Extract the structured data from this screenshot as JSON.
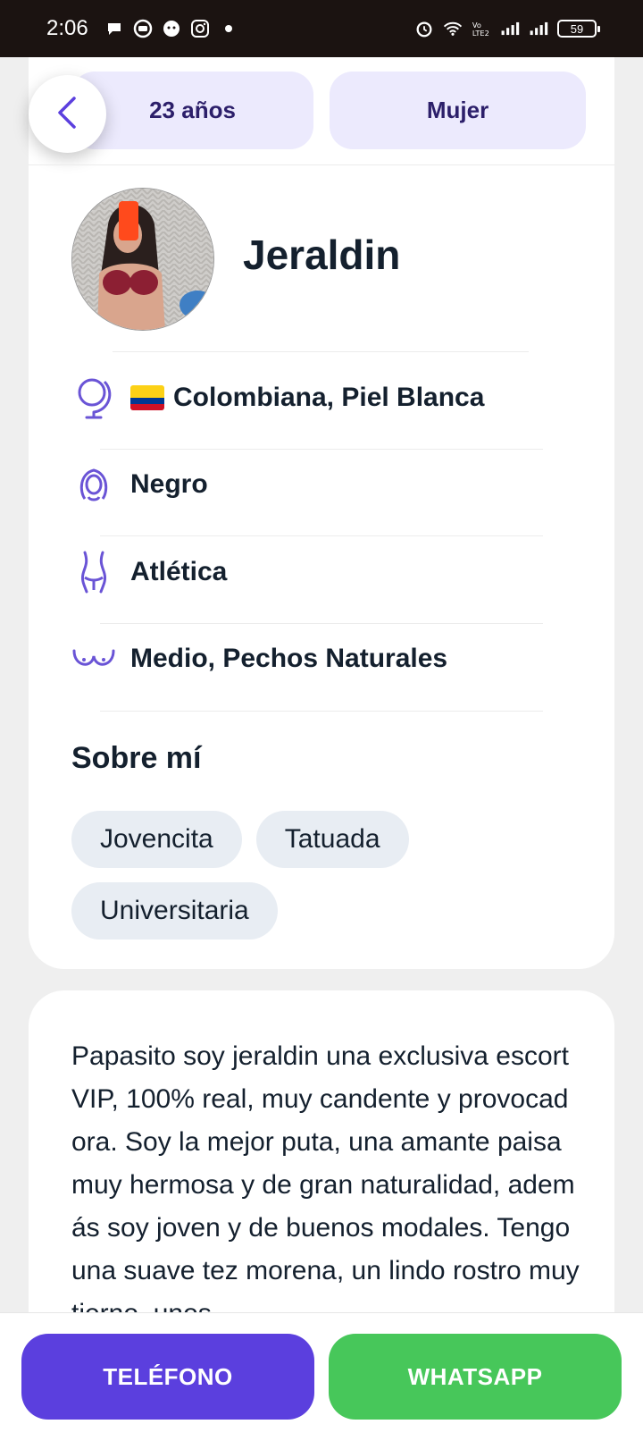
{
  "status_bar": {
    "time": "2:06",
    "battery": "59",
    "left_icons": [
      "chat-icon",
      "message-icon",
      "face-icon",
      "instagram-icon",
      "dot-icon"
    ],
    "right_icons": [
      "alarm-icon",
      "wifi-icon",
      "volte-icon",
      "signal-icon",
      "signal-icon",
      "battery-icon"
    ]
  },
  "profile": {
    "age_chip": "23 años",
    "gender_chip": "Mujer",
    "name": "Jeraldin",
    "attributes": [
      {
        "icon": "globe-icon",
        "flag": "colombia-flag",
        "label": "Colombiana, Piel Blanca"
      },
      {
        "icon": "hair-icon",
        "label": "Negro"
      },
      {
        "icon": "body-icon",
        "label": "Atlética"
      },
      {
        "icon": "bust-icon",
        "label": "Medio, Pechos Naturales"
      }
    ],
    "about_title": "Sobre mí",
    "tags": [
      "Jovencita",
      "Tatuada",
      "Universitaria"
    ]
  },
  "description": "Papasito soy jeraldin una exclusiva escort VIP, 100% real, muy candente y provocadora. Soy la mejor puta, una amante paisa muy hermosa y de gran naturalidad, además soy joven y de buenos modales. Tengo una suave tez morena, un lindo rostro muy tierno, unos",
  "actions": {
    "phone": "TELÉFONO",
    "whatsapp": "WHATSAPP"
  },
  "colors": {
    "accent": "#5b3fde",
    "whatsapp": "#47c75a",
    "chip_bg": "#eceafd",
    "tag_bg": "#e8edf3",
    "icon_purple": "#6a54d6"
  }
}
